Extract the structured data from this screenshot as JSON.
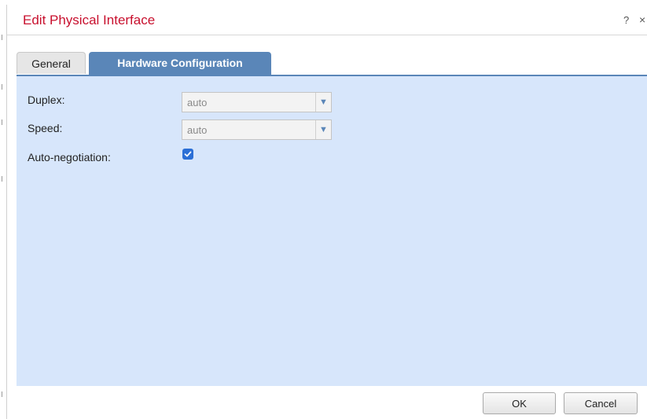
{
  "dialog": {
    "title": "Edit Physical Interface",
    "help_glyph": "?",
    "close_glyph": "×"
  },
  "tabs": [
    {
      "label": "General",
      "active": false
    },
    {
      "label": "Hardware Configuration",
      "active": true
    }
  ],
  "form": {
    "duplex": {
      "label": "Duplex:",
      "value": "auto"
    },
    "speed": {
      "label": "Speed:",
      "value": "auto"
    },
    "auto_negotiation": {
      "label": "Auto-negotiation:",
      "checked": true
    }
  },
  "footer": {
    "ok_label": "OK",
    "cancel_label": "Cancel"
  },
  "colors": {
    "title": "#c8102e",
    "active_tab": "#5a86b8",
    "panel_bg": "#d7e6fb",
    "checkbox": "#2b6fd6"
  }
}
